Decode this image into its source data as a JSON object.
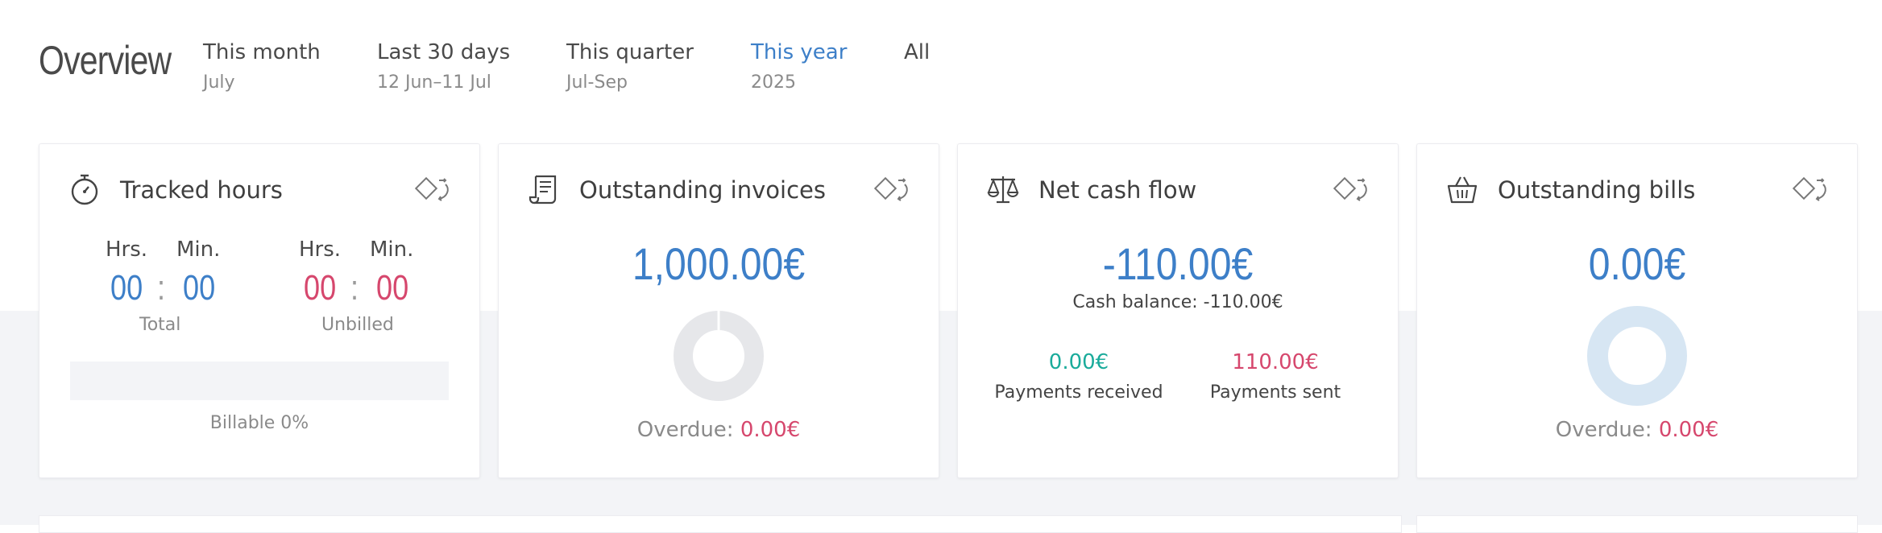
{
  "header": {
    "title": "Overview",
    "periods": [
      {
        "label": "This month",
        "sub": "July"
      },
      {
        "label": "Last 30 days",
        "sub": "12 Jun–11 Jul"
      },
      {
        "label": "This quarter",
        "sub": "Jul-Sep"
      },
      {
        "label": "This year",
        "sub": "2025",
        "active": true
      },
      {
        "label": "All",
        "sub": ""
      }
    ]
  },
  "colors": {
    "accent": "#3d7fc8",
    "negative": "#d6476d",
    "positive": "#1aab9b"
  },
  "tracked": {
    "title": "Tracked hours",
    "icon": "stopwatch-icon",
    "hrs_label": "Hrs.",
    "min_label": "Min.",
    "total": {
      "hours": "00",
      "minutes": "00",
      "label": "Total"
    },
    "unbilled": {
      "hours": "00",
      "minutes": "00",
      "label": "Unbilled"
    },
    "billable_label": "Billable 0%",
    "billable_fraction": 0
  },
  "invoices": {
    "title": "Outstanding invoices",
    "icon": "invoice-scroll-icon",
    "amount": "1,000.00€",
    "overdue_label": "Overdue:",
    "overdue_value": "0.00€"
  },
  "cashflow": {
    "title": "Net cash flow",
    "icon": "balance-scale-icon",
    "amount": "-110.00€",
    "balance": "Cash balance: -110.00€",
    "received_value": "0.00€",
    "received_label": "Payments received",
    "sent_value": "110.00€",
    "sent_label": "Payments sent"
  },
  "bills": {
    "title": "Outstanding bills",
    "icon": "basket-icon",
    "amount": "0.00€",
    "overdue_label": "Overdue:",
    "overdue_value": "0.00€"
  }
}
